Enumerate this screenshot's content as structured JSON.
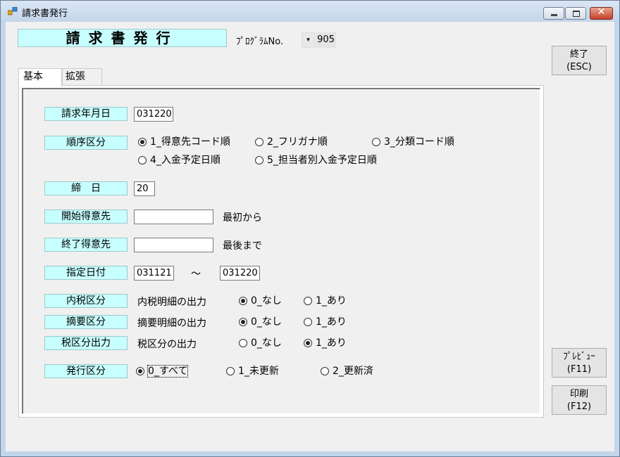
{
  "window": {
    "title": "請求書発行"
  },
  "header": {
    "form_title": "請求書発行",
    "program_label": "ﾌﾟﾛｸﾞﾗﾑNo.",
    "program_dropdown": "▾",
    "program_no": "905"
  },
  "buttons": {
    "exit_line1": "終了",
    "exit_line2": "(ESC)",
    "preview_line1": "ﾌﾟﾚﾋﾞｭｰ",
    "preview_line2": "(F11)",
    "print_line1": "印刷",
    "print_line2": "(F12)"
  },
  "tabs": {
    "basic": "基本",
    "extended": "拡張"
  },
  "form": {
    "billing_month": {
      "label": "請求年月日",
      "value": "031220"
    },
    "order_type": {
      "label": "順序区分",
      "options": [
        "1_得意先コード順",
        "2_フリガナ順",
        "3_分類コード順",
        "4_入金予定日順",
        "5_担当者別入金予定日順"
      ],
      "selected": 0
    },
    "closing_day": {
      "label": "締　日",
      "value": "20"
    },
    "start_customer": {
      "label": "開始得意先",
      "value": "",
      "note": "最初から"
    },
    "end_customer": {
      "label": "終了得意先",
      "value": "",
      "note": "最後まで"
    },
    "date_range": {
      "label": "指定日付",
      "from": "031121",
      "separator": "～",
      "to": "031220"
    },
    "inclusive_tax": {
      "label": "内税区分",
      "desc": "内税明細の出力",
      "options": [
        "0_なし",
        "1_あり"
      ],
      "selected": 0
    },
    "summary": {
      "label": "摘要区分",
      "desc": "摘要明細の出力",
      "options": [
        "0_なし",
        "1_あり"
      ],
      "selected": 0
    },
    "tax_output": {
      "label": "税区分出力",
      "desc": "税区分の出力",
      "options": [
        "0_なし",
        "1_あり"
      ],
      "selected": 1
    },
    "issue_type": {
      "label": "発行区分",
      "options": [
        "0_すべて",
        "1_未更新",
        "2_更新済"
      ],
      "selected": 0
    }
  },
  "colors": {
    "label_bg": "#c7ffff",
    "title_bar": "#c3d5ea"
  }
}
